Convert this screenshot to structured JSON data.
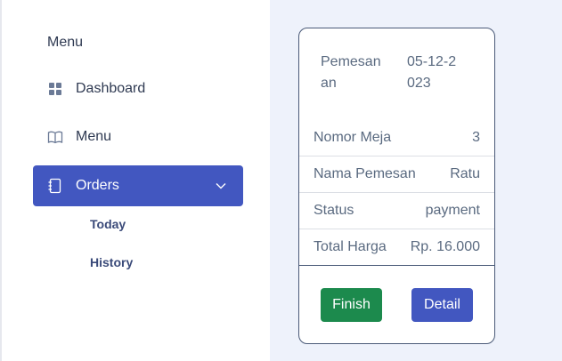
{
  "sidebar": {
    "heading": "Menu",
    "items": [
      {
        "label": "Dashboard",
        "icon": "dashboard-grid-icon"
      },
      {
        "label": "Menu",
        "icon": "book-icon"
      },
      {
        "label": "Orders",
        "icon": "notebook-icon"
      }
    ],
    "orders_sub": [
      {
        "label": "Today"
      },
      {
        "label": "History"
      }
    ]
  },
  "order_card": {
    "date_label": "Pemesanan",
    "date_value": "05-12-2023",
    "rows": [
      {
        "label": "Nomor Meja",
        "value": "3"
      },
      {
        "label": "Nama Pemesan",
        "value": "Ratu"
      },
      {
        "label": "Status",
        "value": "payment"
      },
      {
        "label": "Total Harga",
        "value": "Rp. 16.000"
      }
    ],
    "finish_label": "Finish",
    "detail_label": "Detail"
  },
  "colors": {
    "accent": "#4257c0",
    "finish": "#1c8a4d",
    "background": "#eef2fb"
  }
}
